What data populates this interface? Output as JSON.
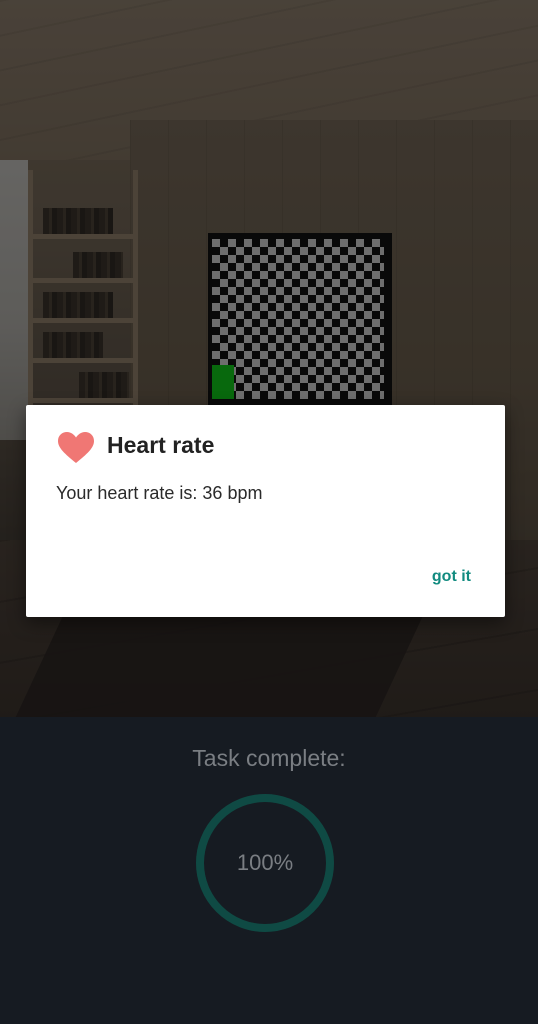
{
  "dialog": {
    "title": "Heart rate",
    "message": "Your heart rate is: 36 bpm",
    "button_label": "got it",
    "icon": "heart-icon",
    "icon_color": "#f07774",
    "button_color": "#128b80"
  },
  "task": {
    "label": "Task complete:",
    "progress_text": "100%",
    "progress_fraction": 1.0,
    "ring_color": "#0f4a44"
  }
}
